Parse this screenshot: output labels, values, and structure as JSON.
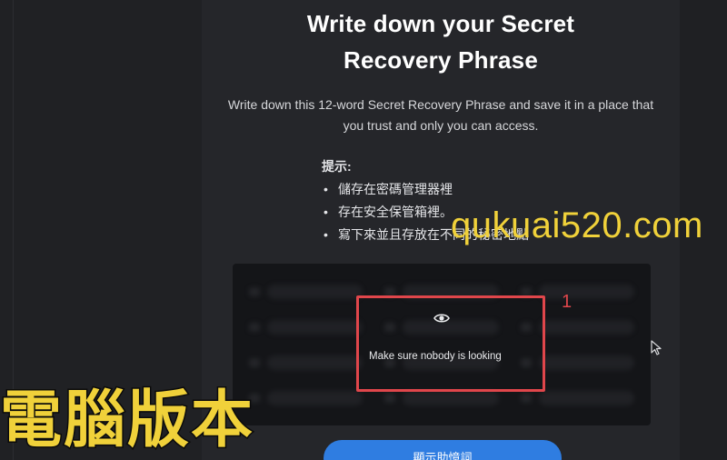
{
  "header": {
    "title_line1": "Write down your Secret",
    "title_line2": "Recovery Phrase",
    "description": "Write down this 12-word Secret Recovery Phrase and save it in a place that you trust and only you can access."
  },
  "tips": {
    "title": "提示:",
    "items": [
      "儲存在密碼管理器裡",
      "存在安全保管箱裡。",
      "寫下來並且存放在不同的秘密地點"
    ]
  },
  "phrase_box": {
    "reveal_text": "Make sure nobody is looking",
    "eye_icon": "eye-icon"
  },
  "annotation": {
    "number": "1",
    "color": "#e0464b"
  },
  "reveal_button": {
    "label": "顯示助憶詞",
    "color": "#2f7de1"
  },
  "overlay": {
    "watermark": "qukuai520.com",
    "caption": "電腦版本",
    "color": "#f0d13a"
  }
}
